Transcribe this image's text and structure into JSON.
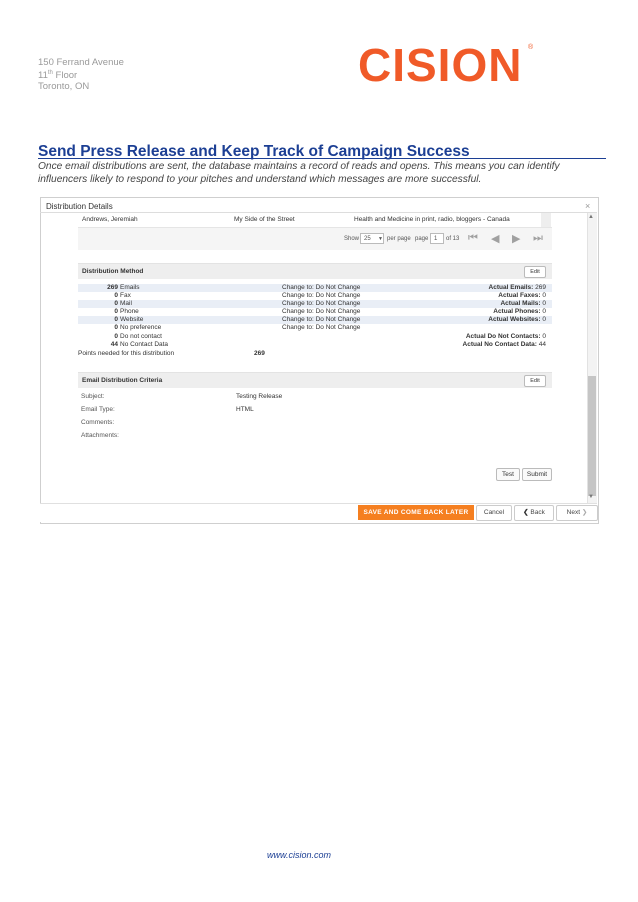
{
  "header": {
    "address_line1": "150 Ferrand Avenue",
    "address_floor_num": "11",
    "address_floor_sup": "th",
    "address_floor_word": " Floor",
    "address_line3": "Toronto, ON",
    "logo_text": "CISION",
    "logo_mark": "®",
    "brand_color": "#f05a28"
  },
  "article": {
    "title": "Send Press Release and Keep Track of Campaign Success",
    "intro_line1": "Once email distributions are sent, the database maintains a record of reads and opens. This means you can identify",
    "intro_line2": "influencers likely to respond to your pitches and understand which messages are more successful."
  },
  "dialog": {
    "title": "Distribution Details",
    "close_icon": "×",
    "top_row": {
      "name": "Andrews, Jeremiah",
      "outlet": "My Side of the Street",
      "topic": "Health and Medicine in print, radio, bloggers - Canada"
    },
    "pager": {
      "show_label": "Show",
      "show_value": "25",
      "per_page_label": "per page",
      "page_label": "page",
      "page_value": "1",
      "of_label": "of 13"
    },
    "distribution_method": {
      "title": "Distribution Method",
      "edit_label": "Edit",
      "rows": [
        {
          "count": "269",
          "label": "Emails",
          "change": "Change to: Do Not Change",
          "actual_label": "Actual Emails:",
          "actual_value": "269"
        },
        {
          "count": "0",
          "label": "Fax",
          "change": "Change to: Do Not Change",
          "actual_label": "Actual Faxes:",
          "actual_value": "0"
        },
        {
          "count": "0",
          "label": "Mail",
          "change": "Change to: Do Not Change",
          "actual_label": "Actual Mails:",
          "actual_value": "0"
        },
        {
          "count": "0",
          "label": "Phone",
          "change": "Change to: Do Not Change",
          "actual_label": "Actual Phones:",
          "actual_value": "0"
        },
        {
          "count": "0",
          "label": "Website",
          "change": "Change to: Do Not Change",
          "actual_label": "Actual Websites:",
          "actual_value": "0"
        },
        {
          "count": "0",
          "label": "No preference",
          "change": "Change to: Do Not Change",
          "actual_label": "",
          "actual_value": ""
        },
        {
          "count": "0",
          "label": "Do not contact",
          "change": "",
          "actual_label": "Actual Do Not Contacts:",
          "actual_value": "0"
        },
        {
          "count": "44",
          "label": "No Contact Data",
          "change": "",
          "actual_label": "Actual No Contact Data:",
          "actual_value": "44"
        }
      ],
      "points_label": "Points needed for this distribution",
      "points_value": "269"
    },
    "criteria": {
      "title": "Email Distribution Criteria",
      "edit_label": "Edit",
      "subject_label": "Subject:",
      "subject_value": "Testing Release",
      "type_label": "Email Type:",
      "type_value": "HTML",
      "comments_label": "Comments:",
      "attachments_label": "Attachments:"
    },
    "test_label": "Test",
    "submit_label": "Submit",
    "footer": {
      "save_later_label": "SAVE AND COME BACK LATER",
      "cancel_label": "Cancel",
      "back_label": "Back",
      "next_label": "Next"
    }
  },
  "footer": {
    "url": "www.cision.com"
  }
}
